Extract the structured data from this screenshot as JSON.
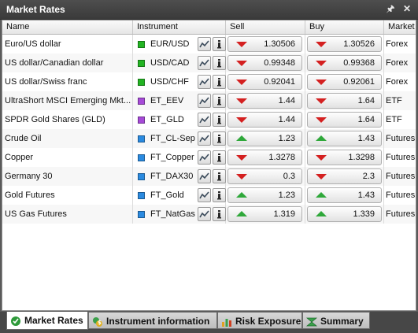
{
  "window": {
    "title": "Market Rates",
    "pin_icon": "pin-icon",
    "close_icon": "close-icon"
  },
  "columns": {
    "name": "Name",
    "instrument": "Instrument",
    "sell": "Sell",
    "buy": "Buy",
    "market": "Market"
  },
  "colors": {
    "forex": "#22b422",
    "etf": "#a64ad8",
    "futures": "#2a8ae0",
    "down": "#d42020",
    "up": "#2fa83a"
  },
  "rows": [
    {
      "name": "Euro/US dollar",
      "code": "EUR/USD",
      "color": "#22b422",
      "sell": "1.30506",
      "buy": "1.30526",
      "sell_dir": "down",
      "buy_dir": "down",
      "market": "Forex"
    },
    {
      "name": "US dollar/Canadian dollar",
      "code": "USD/CAD",
      "color": "#22b422",
      "sell": "0.99348",
      "buy": "0.99368",
      "sell_dir": "down",
      "buy_dir": "down",
      "market": "Forex"
    },
    {
      "name": "US dollar/Swiss franc",
      "code": "USD/CHF",
      "color": "#22b422",
      "sell": "0.92041",
      "buy": "0.92061",
      "sell_dir": "down",
      "buy_dir": "down",
      "market": "Forex"
    },
    {
      "name": "UltraShort MSCI Emerging Mkt...",
      "code": "ET_EEV",
      "color": "#a64ad8",
      "sell": "1.44",
      "buy": "1.64",
      "sell_dir": "down",
      "buy_dir": "down",
      "market": "ETF"
    },
    {
      "name": "SPDR Gold Shares (GLD)",
      "code": "ET_GLD",
      "color": "#a64ad8",
      "sell": "1.44",
      "buy": "1.64",
      "sell_dir": "down",
      "buy_dir": "down",
      "market": "ETF"
    },
    {
      "name": "Crude Oil",
      "code": "FT_CL-Sep",
      "color": "#2a8ae0",
      "sell": "1.23",
      "buy": "1.43",
      "sell_dir": "up",
      "buy_dir": "up",
      "market": "Futures"
    },
    {
      "name": "Copper",
      "code": "FT_Copper",
      "color": "#2a8ae0",
      "sell": "1.3278",
      "buy": "1.3298",
      "sell_dir": "down",
      "buy_dir": "down",
      "market": "Futures"
    },
    {
      "name": "Germany 30",
      "code": "FT_DAX30",
      "color": "#2a8ae0",
      "sell": "0.3",
      "buy": "2.3",
      "sell_dir": "down",
      "buy_dir": "down",
      "market": "Futures"
    },
    {
      "name": "Gold Futures",
      "code": "FT_Gold",
      "color": "#2a8ae0",
      "sell": "1.23",
      "buy": "1.43",
      "sell_dir": "up",
      "buy_dir": "up",
      "market": "Futures"
    },
    {
      "name": "US Gas Futures",
      "code": "FT_NatGas",
      "color": "#2a8ae0",
      "sell": "1.319",
      "buy": "1.339",
      "sell_dir": "up",
      "buy_dir": "up",
      "market": "Futures"
    }
  ],
  "tabs": [
    {
      "label": "Market Rates",
      "icon": "market-rates-icon",
      "active": true
    },
    {
      "label": "Instrument information",
      "icon": "instrument-info-icon",
      "active": false
    },
    {
      "label": "Risk Exposure",
      "icon": "risk-exposure-icon",
      "active": false
    },
    {
      "label": "Summary",
      "icon": "summary-icon",
      "active": false
    }
  ]
}
